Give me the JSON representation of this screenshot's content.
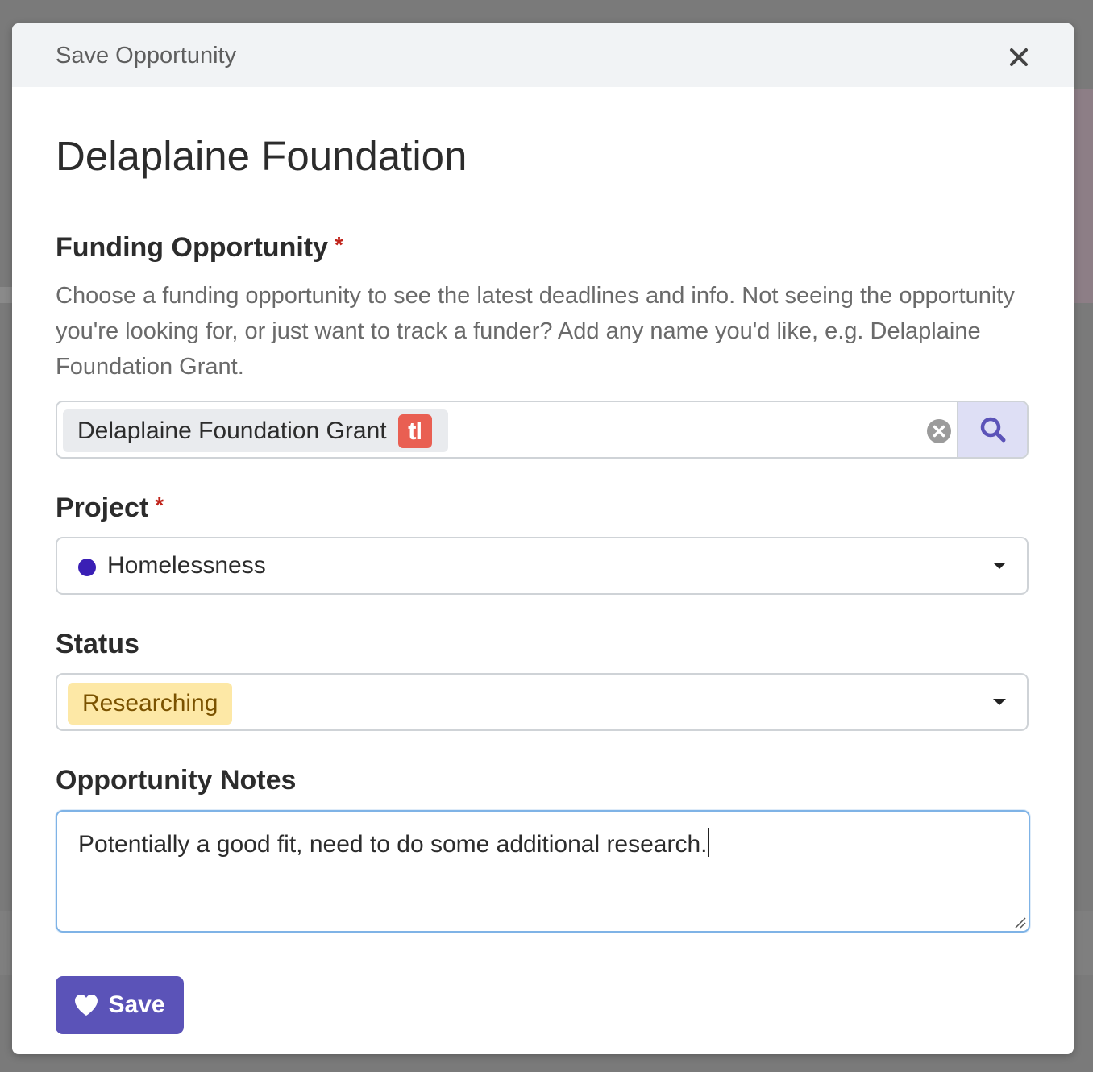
{
  "modal": {
    "title": "Save Opportunity",
    "org_name": "Delaplaine Foundation"
  },
  "funding": {
    "label": "Funding Opportunity",
    "required_mark": "*",
    "help": "Choose a funding opportunity to see the latest deadlines and info. Not seeing the opportunity you're looking for, or just want to track a funder? Add any name you'd like, e.g. Delaplaine Foundation Grant.",
    "value": "Delaplaine Foundation Grant",
    "badge": "tl",
    "badge_color": "#e95f52"
  },
  "project": {
    "label": "Project",
    "required_mark": "*",
    "value": "Homelessness",
    "dot_color": "#3a1fb5"
  },
  "status": {
    "label": "Status",
    "value": "Researching",
    "pill_bg": "#fde8a6",
    "pill_fg": "#7a5200"
  },
  "notes": {
    "label": "Opportunity Notes",
    "value": "Potentially a good fit, need to do some additional research."
  },
  "save": {
    "label": "Save"
  },
  "icons": {
    "close": "close-icon",
    "clear": "clear-circle-icon",
    "search": "search-icon",
    "caret": "chevron-down-icon",
    "heart": "heart-icon"
  },
  "colors": {
    "accent": "#5b53b8",
    "required": "#c0231a",
    "focus": "#7fb3e6"
  }
}
